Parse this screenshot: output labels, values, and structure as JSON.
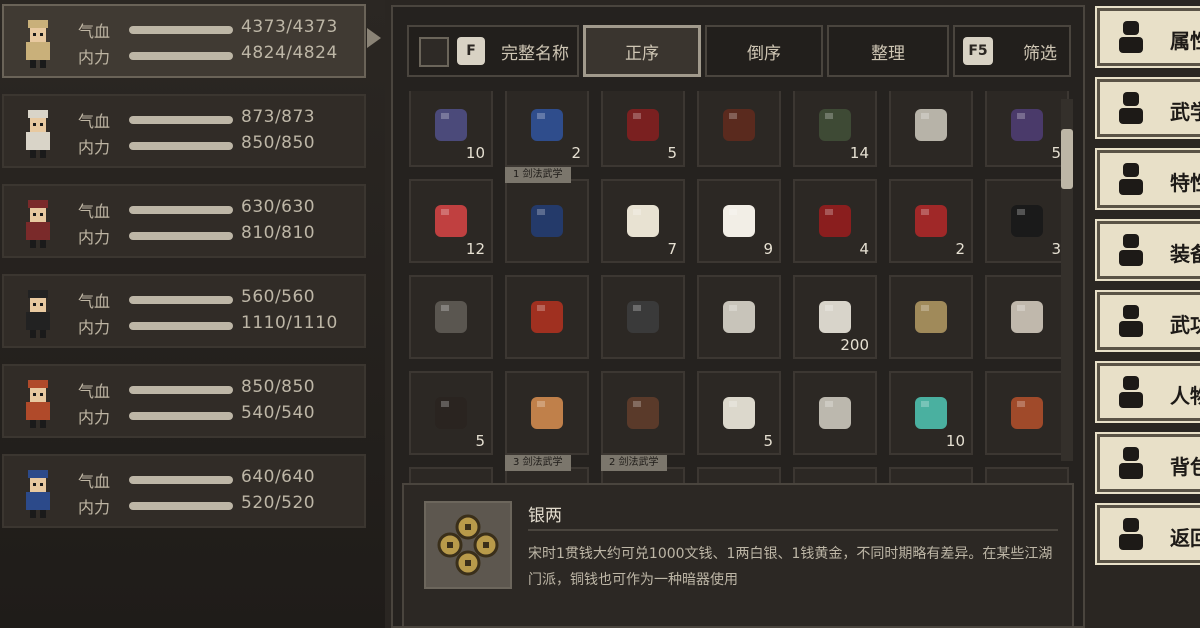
{
  "party": [
    {
      "hp_label": "气血",
      "hp": "4373/4373",
      "mp_label": "内力",
      "mp": "4824/4824",
      "selected": true
    },
    {
      "hp_label": "气血",
      "hp": "873/873",
      "mp_label": "内力",
      "mp": "850/850"
    },
    {
      "hp_label": "气血",
      "hp": "630/630",
      "mp_label": "内力",
      "mp": "810/810"
    },
    {
      "hp_label": "气血",
      "hp": "560/560",
      "mp_label": "内力",
      "mp": "1110/1110"
    },
    {
      "hp_label": "气血",
      "hp": "850/850",
      "mp_label": "内力",
      "mp": "540/540"
    },
    {
      "hp_label": "气血",
      "hp": "640/640",
      "mp_label": "内力",
      "mp": "520/520"
    }
  ],
  "toolbar": {
    "fullname_key": "F",
    "fullname_label": "完整名称",
    "sort_asc": "正序",
    "sort_desc": "倒序",
    "organize": "整理",
    "filter_key": "F5",
    "filter_label": "筛选"
  },
  "items": [
    {
      "icon": "skull-orb",
      "count": "10"
    },
    {
      "icon": "crystal-ball",
      "count": "2"
    },
    {
      "icon": "red-book",
      "count": "5"
    },
    {
      "icon": "sticks",
      "count": ""
    },
    {
      "icon": "jar",
      "count": "14"
    },
    {
      "icon": "sword",
      "count": ""
    },
    {
      "icon": "pot",
      "count": "5"
    },
    {
      "icon": "needles",
      "count": "12"
    },
    {
      "icon": "manual",
      "count": "",
      "tag": "1 剑法武学"
    },
    {
      "icon": "gourd",
      "count": "7"
    },
    {
      "icon": "buns",
      "count": "9"
    },
    {
      "icon": "red-jar",
      "count": "4"
    },
    {
      "icon": "armor",
      "count": "2"
    },
    {
      "icon": "pills",
      "count": "3"
    },
    {
      "icon": "frame",
      "count": ""
    },
    {
      "icon": "red-shell",
      "count": ""
    },
    {
      "icon": "robe",
      "count": ""
    },
    {
      "icon": "flute",
      "count": ""
    },
    {
      "icon": "darts",
      "count": "200"
    },
    {
      "icon": "hat",
      "count": ""
    },
    {
      "icon": "dagger",
      "count": ""
    },
    {
      "icon": "wine-jar",
      "count": "5"
    },
    {
      "icon": "mushroom",
      "count": ""
    },
    {
      "icon": "box",
      "count": ""
    },
    {
      "icon": "vase",
      "count": "5"
    },
    {
      "icon": "scroll",
      "count": ""
    },
    {
      "icon": "jade",
      "count": "10"
    },
    {
      "icon": "soup",
      "count": ""
    },
    {
      "icon": "partial",
      "count": ""
    },
    {
      "icon": "partial",
      "count": "",
      "tag": "3 剑法武学"
    },
    {
      "icon": "partial",
      "count": "",
      "tag": "2 剑法武学"
    },
    {
      "icon": "partial",
      "count": ""
    },
    {
      "icon": "partial",
      "count": ""
    },
    {
      "icon": "partial",
      "count": ""
    },
    {
      "icon": "partial",
      "count": ""
    }
  ],
  "description": {
    "title": "银两",
    "text": "宋时1贯钱大约可兑1000文钱、1两白银、1钱黄金，不同时期略有差异。在某些江湖门派，铜钱也可作为一种暗器使用"
  },
  "menu": [
    {
      "label": "属性",
      "icon": "character-icon"
    },
    {
      "label": "武学",
      "icon": "martial-icon"
    },
    {
      "label": "特性",
      "icon": "trait-icon"
    },
    {
      "label": "装备",
      "icon": "sword-icon"
    },
    {
      "label": "武功",
      "icon": "book-icon"
    },
    {
      "label": "人物",
      "icon": "diamond-icon"
    },
    {
      "label": "背包",
      "icon": "bag-icon"
    },
    {
      "label": "返回",
      "icon": "door-icon"
    }
  ],
  "colors": {
    "accent": "#a19a8c",
    "menu_bg": "#e8e0c8",
    "bar": "#bdb6a6"
  }
}
